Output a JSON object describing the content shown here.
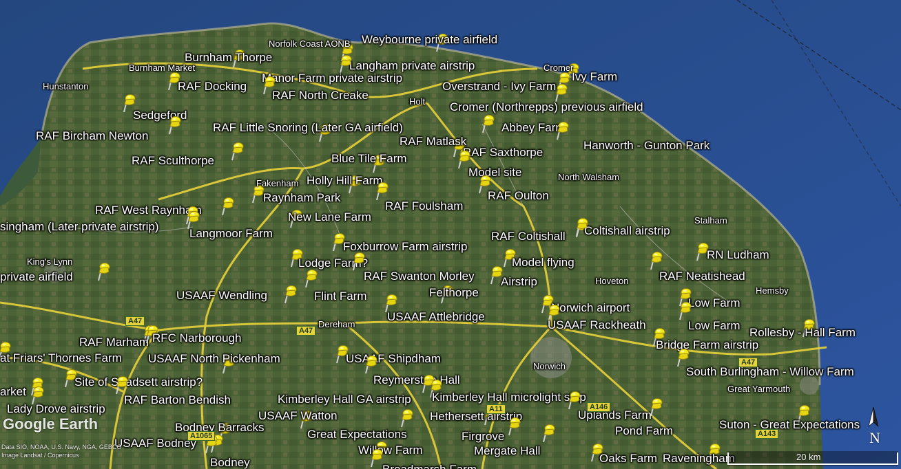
{
  "map": {
    "colors": {
      "sea": "#2a4f8c",
      "land": "#4a6034",
      "road": "#e8d23a",
      "pin": "#f4ec1a"
    },
    "pins": [
      {
        "label": "Weybourne private airfield",
        "icon": "yellow-pushpin-icon"
      },
      {
        "label": "Burnham Thorpe",
        "icon": "yellow-pushpin-icon"
      },
      {
        "label": "Langham private airstrip",
        "icon": "yellow-pushpin-icon"
      },
      {
        "label": "Manor Farm private airstrip",
        "icon": "yellow-pushpin-icon"
      },
      {
        "label": "Ivy Farm",
        "icon": "yellow-pushpin-icon"
      },
      {
        "label": "RAF Docking",
        "icon": "yellow-pushpin-icon"
      },
      {
        "label": "RAF North Creake",
        "icon": "yellow-pushpin-icon"
      },
      {
        "label": "Overstrand - Ivy Farm",
        "icon": "yellow-pushpin-icon"
      },
      {
        "label": "Cromer (Northrepps) previous airfield",
        "icon": "yellow-pushpin-icon"
      },
      {
        "label": "Sedgeford",
        "icon": "yellow-pushpin-icon"
      },
      {
        "label": "RAF Little Snoring (Later GA airfield)",
        "icon": "yellow-pushpin-icon"
      },
      {
        "label": "Abbey Farm",
        "icon": "yellow-pushpin-icon"
      },
      {
        "label": "RAF Bircham Newton",
        "icon": "yellow-pushpin-icon"
      },
      {
        "label": "RAF Matlask",
        "icon": "yellow-pushpin-icon"
      },
      {
        "label": "Hanworth - Gunton Park",
        "icon": "yellow-pushpin-icon"
      },
      {
        "label": "RAF Saxthorpe",
        "icon": "yellow-pushpin-icon"
      },
      {
        "label": "RAF Sculthorpe",
        "icon": "yellow-pushpin-icon"
      },
      {
        "label": "Blue Tile Farm",
        "icon": "yellow-pushpin-icon"
      },
      {
        "label": "Model site",
        "icon": "yellow-pushpin-icon"
      },
      {
        "label": "Holly Hill Farm",
        "icon": "yellow-pushpin-icon"
      },
      {
        "label": "RAF Oulton",
        "icon": "yellow-pushpin-icon"
      },
      {
        "label": "Raynham Park",
        "icon": "yellow-pushpin-icon"
      },
      {
        "label": "RAF Foulsham",
        "icon": "yellow-pushpin-icon"
      },
      {
        "label": "RAF West Raynham",
        "icon": "yellow-pushpin-icon"
      },
      {
        "label": "New Lane Farm",
        "icon": "yellow-pushpin-icon"
      },
      {
        "label": "singham (Later private airstrip)",
        "icon": "yellow-pushpin-icon"
      },
      {
        "label": "Langmoor Farm",
        "icon": "yellow-pushpin-icon"
      },
      {
        "label": "Coltishall airstrip",
        "icon": "yellow-pushpin-icon"
      },
      {
        "label": "RAF Coltishall",
        "icon": "yellow-pushpin-icon"
      },
      {
        "label": "Foxburrow Farm airstrip",
        "icon": "yellow-pushpin-icon"
      },
      {
        "label": "RN Ludham",
        "icon": "yellow-pushpin-icon"
      },
      {
        "label": "Model flying",
        "icon": "yellow-pushpin-icon"
      },
      {
        "label": "Lodge Farm?",
        "icon": "yellow-pushpin-icon"
      },
      {
        "label": "RAF Neatishead",
        "icon": "yellow-pushpin-icon"
      },
      {
        "label": "private airfield",
        "icon": "yellow-pushpin-icon"
      },
      {
        "label": "RAF Swanton Morley",
        "icon": "yellow-pushpin-icon"
      },
      {
        "label": "Airstrip",
        "icon": "yellow-pushpin-icon"
      },
      {
        "label": "Felthorpe",
        "icon": "yellow-pushpin-icon"
      },
      {
        "label": "USAAF Wendling",
        "icon": "yellow-pushpin-icon"
      },
      {
        "label": "Flint Farm",
        "icon": "yellow-pushpin-icon"
      },
      {
        "label": "Low Farm",
        "icon": "yellow-pushpin-icon"
      },
      {
        "label": "Norwich airport",
        "icon": "yellow-pushpin-icon"
      },
      {
        "label": "USAAF Attlebridge",
        "icon": "yellow-pushpin-icon"
      },
      {
        "label": "USAAF Rackheath",
        "icon": "yellow-pushpin-icon"
      },
      {
        "label": "Low Farm",
        "icon": "yellow-pushpin-icon"
      },
      {
        "label": "Rollesby - Hall Farm",
        "icon": "yellow-pushpin-icon"
      },
      {
        "label": "RAF Marham",
        "icon": "yellow-pushpin-icon"
      },
      {
        "label": "RFC Narborough",
        "icon": "yellow-pushpin-icon"
      },
      {
        "label": "Bridge Farm airstrip",
        "icon": "yellow-pushpin-icon"
      },
      {
        "label": "at Friars' Thornes Farm",
        "icon": "yellow-pushpin-icon"
      },
      {
        "label": "USAAF North Pickenham",
        "icon": "yellow-pushpin-icon"
      },
      {
        "label": "USAAF Shipdham",
        "icon": "yellow-pushpin-icon"
      },
      {
        "label": "South Burlingham - Willow Farm",
        "icon": "yellow-pushpin-icon"
      },
      {
        "label": "Site of Stradsett airstrip?",
        "icon": "yellow-pushpin-icon"
      },
      {
        "label": "Reymerston Hall",
        "icon": "yellow-pushpin-icon"
      },
      {
        "label": "arket",
        "icon": "yellow-pushpin-icon"
      },
      {
        "label": "RAF Barton Bendish",
        "icon": "yellow-pushpin-icon"
      },
      {
        "label": "Kimberley Hall GA airstrip",
        "icon": "yellow-pushpin-icon"
      },
      {
        "label": "Kimberley Hall microlight strip",
        "icon": "yellow-pushpin-icon"
      },
      {
        "label": "Lady Drove airstrip",
        "icon": "yellow-pushpin-icon"
      },
      {
        "label": "USAAF Watton",
        "icon": "yellow-pushpin-icon"
      },
      {
        "label": "Hethersett airstrip",
        "icon": "yellow-pushpin-icon"
      },
      {
        "label": "Uplands Farm",
        "icon": "yellow-pushpin-icon"
      },
      {
        "label": "Bodney Barracks",
        "icon": "yellow-pushpin-icon"
      },
      {
        "label": "Suton - Great Expectations",
        "icon": "yellow-pushpin-icon"
      },
      {
        "label": "Great Expectations",
        "icon": "yellow-pushpin-icon"
      },
      {
        "label": "Pond Farm",
        "icon": "yellow-pushpin-icon"
      },
      {
        "label": "Firgrove",
        "icon": "yellow-pushpin-icon"
      },
      {
        "label": "USAAF Bodney",
        "icon": "yellow-pushpin-icon"
      },
      {
        "label": "Willow Farm",
        "icon": "yellow-pushpin-icon"
      },
      {
        "label": "Mergate Hall",
        "icon": "yellow-pushpin-icon"
      },
      {
        "label": "Bodney",
        "icon": "yellow-pushpin-icon"
      },
      {
        "label": "Oaks Farm",
        "icon": "yellow-pushpin-icon"
      },
      {
        "label": "Raveningham",
        "icon": "yellow-pushpin-icon"
      },
      {
        "label": "Broadmarsh Farm",
        "icon": "yellow-pushpin-icon"
      }
    ],
    "places": [
      "Norfolk Coast AONB",
      "Burnham Market",
      "Hunstanton",
      "Cromer",
      "Holt",
      "Fakenham",
      "North Walsham",
      "Stalham",
      "King's Lynn",
      "Hoveton",
      "Hemsby",
      "Dereham",
      "Norwich",
      "Great Yarmouth"
    ],
    "roads": [
      "A47",
      "A47",
      "A47",
      "A11",
      "A146",
      "A1065",
      "A143"
    ],
    "attribution": {
      "brand": "Google Earth",
      "credits_line1": "Data SIO, NOAA, U.S. Navy, NGA, GEBCO",
      "credits_line2": "Image Landsat / Copernicus"
    },
    "scale_label": "20 km",
    "compass_label": "N",
    "compass_icon": "north-arrow-icon"
  }
}
